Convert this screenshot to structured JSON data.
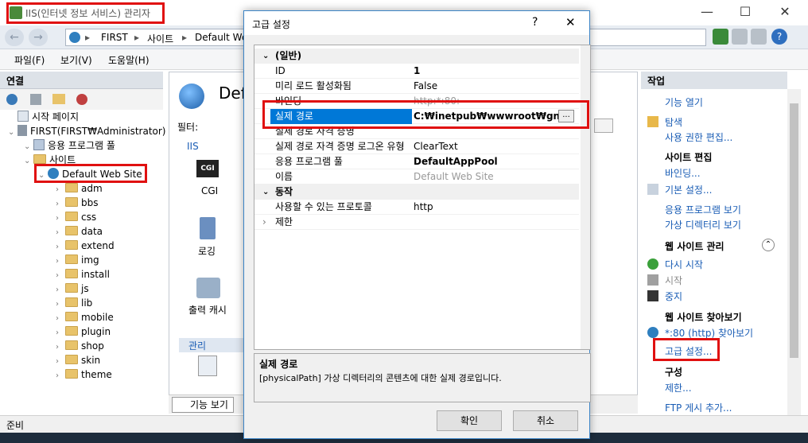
{
  "window": {
    "title": "IIS(인터넷 정보 서비스) 관리자",
    "minimize": "—",
    "maximize": "☐",
    "close": "✕"
  },
  "address": {
    "crumbs": [
      "FIRST",
      "사이트",
      "Default Web"
    ],
    "sep": "▸",
    "back": "←",
    "forward": "→",
    "help": "?"
  },
  "menu": [
    "파일(F)",
    "보기(V)",
    "도움말(H)"
  ],
  "left": {
    "header": "연결",
    "tree": [
      {
        "label": "시작 페이지",
        "level": 1,
        "kind": "page"
      },
      {
        "label": "FIRST(FIRST₩Administrator)",
        "level": 1,
        "kind": "server"
      },
      {
        "label": "응용 프로그램 풀",
        "level": 2,
        "kind": "pool"
      },
      {
        "label": "사이트",
        "level": 2,
        "kind": "folder"
      },
      {
        "label": "Default Web Site",
        "level": 3,
        "kind": "site"
      },
      {
        "label": "adm",
        "level": 4,
        "kind": "folder"
      },
      {
        "label": "bbs",
        "level": 4,
        "kind": "folder"
      },
      {
        "label": "css",
        "level": 4,
        "kind": "folder"
      },
      {
        "label": "data",
        "level": 4,
        "kind": "folder"
      },
      {
        "label": "extend",
        "level": 4,
        "kind": "folder"
      },
      {
        "label": "img",
        "level": 4,
        "kind": "folder"
      },
      {
        "label": "install",
        "level": 4,
        "kind": "folder"
      },
      {
        "label": "js",
        "level": 4,
        "kind": "folder"
      },
      {
        "label": "lib",
        "level": 4,
        "kind": "folder"
      },
      {
        "label": "mobile",
        "level": 4,
        "kind": "folder"
      },
      {
        "label": "plugin",
        "level": 4,
        "kind": "folder"
      },
      {
        "label": "shop",
        "level": 4,
        "kind": "folder"
      },
      {
        "label": "skin",
        "level": 4,
        "kind": "folder"
      },
      {
        "label": "theme",
        "level": 4,
        "kind": "folder"
      }
    ]
  },
  "center": {
    "title": "Defa",
    "filter_label": "필터:",
    "group_iis": "IIS",
    "features": [
      "CGI",
      "로깅",
      "출력 캐시"
    ],
    "cgi_badge": "CGI",
    "group_manage": "관리",
    "view_tab": "기능 보기"
  },
  "right": {
    "header": "작업",
    "items": [
      {
        "type": "link",
        "label": "기능 열기"
      },
      {
        "type": "link",
        "label": "탐색",
        "icon": "folder"
      },
      {
        "type": "link",
        "label": "사용 권한 편집..."
      },
      {
        "type": "head",
        "label": "사이트 편집"
      },
      {
        "type": "link",
        "label": "바인딩..."
      },
      {
        "type": "link",
        "label": "기본 설정...",
        "icon": "doc"
      },
      {
        "type": "link",
        "label": "응용 프로그램 보기"
      },
      {
        "type": "link",
        "label": "가상 디렉터리 보기"
      },
      {
        "type": "head",
        "label": "웹 사이트 관리"
      },
      {
        "type": "link",
        "label": "다시 시작",
        "icon": "restart"
      },
      {
        "type": "disabled",
        "label": "시작",
        "icon": "start"
      },
      {
        "type": "link",
        "label": "중지",
        "icon": "stop"
      },
      {
        "type": "head",
        "label": "웹 사이트 찾아보기"
      },
      {
        "type": "link",
        "label": "*:80 (http) 찾아보기",
        "icon": "browse"
      },
      {
        "type": "link",
        "label": "고급 설정..."
      },
      {
        "type": "head",
        "label": "구성"
      },
      {
        "type": "link",
        "label": "제한..."
      },
      {
        "type": "link",
        "label": "FTP 게시 추가..."
      }
    ]
  },
  "status": {
    "text": "준비"
  },
  "dialog": {
    "title": "고급 설정",
    "help": "?",
    "close": "✕",
    "groups": [
      {
        "label": "(일반)",
        "expanded": true,
        "rows": [
          {
            "name": "ID",
            "value": "1",
            "bold": true
          },
          {
            "name": "미리 로드 활성화됨",
            "value": "False"
          },
          {
            "name": "바인딩",
            "value": "http:*:80:",
            "grey": true
          },
          {
            "name": "실제 경로",
            "value": "C:₩inetpub₩wwwroot₩gnu",
            "bold": true,
            "selected": true
          },
          {
            "name": "실제 경로 자격 증명",
            "value": ""
          },
          {
            "name": "실제 경로 자격 증명 로그온 유형",
            "value": "ClearText"
          },
          {
            "name": "응용 프로그램 풀",
            "value": "DefaultAppPool",
            "bold": true
          },
          {
            "name": "이름",
            "value": "Default Web Site",
            "grey": true
          }
        ]
      },
      {
        "label": "동작",
        "expanded": true,
        "rows": [
          {
            "name": "사용할 수 있는 프로토콜",
            "value": "http"
          },
          {
            "name": "제한",
            "value": "",
            "collapsed": true
          }
        ]
      }
    ],
    "browse_btn": "...",
    "desc_title": "실제 경로",
    "desc_text": "[physicalPath] 가상 디렉터리의 콘텐츠에 대한 실제 경로입니다.",
    "ok": "확인",
    "cancel": "취소"
  },
  "colors": {
    "highlight": "#e01010",
    "select": "#0078d7",
    "link": "#1a5db5"
  }
}
